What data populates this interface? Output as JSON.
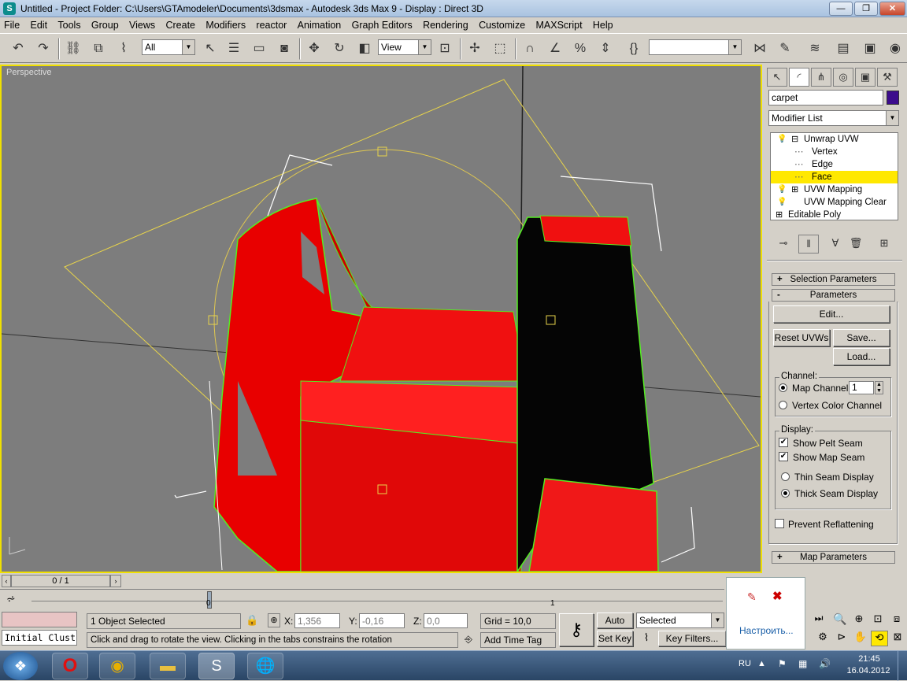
{
  "titlebar": {
    "app_icon": "3ds-max-icon",
    "title": "Untitled      - Project Folder: C:\\Users\\GTAmodeler\\Documents\\3dsmax     - Autodesk 3ds Max 9      - Display : Direct 3D",
    "minimize": "—",
    "maximize": "❐",
    "close": "✕"
  },
  "menu": [
    "File",
    "Edit",
    "Tools",
    "Group",
    "Views",
    "Create",
    "Modifiers",
    "reactor",
    "Animation",
    "Graph Editors",
    "Rendering",
    "Customize",
    "MAXScript",
    "Help"
  ],
  "toolbar": {
    "selection_filter": "All",
    "coord_system": "View",
    "named_selection": ""
  },
  "viewport": {
    "label": "Perspective"
  },
  "command_panel": {
    "object_name": "carpet",
    "object_color": "#3c0c8c",
    "modifier_list": "Modifier List",
    "stack": [
      {
        "label": "Unwrap UVW",
        "level": 0,
        "expand": "⊟",
        "bulb": true,
        "selected": false
      },
      {
        "label": "Vertex",
        "level": 2,
        "expand": "",
        "bulb": false,
        "selected": false
      },
      {
        "label": "Edge",
        "level": 2,
        "expand": "",
        "bulb": false,
        "selected": false
      },
      {
        "label": "Face",
        "level": 2,
        "expand": "",
        "bulb": false,
        "selected": true
      },
      {
        "label": "UVW Mapping",
        "level": 0,
        "expand": "⊞",
        "bulb": true,
        "selected": false
      },
      {
        "label": "UVW Mapping Clear",
        "level": 0,
        "expand": "",
        "bulb": true,
        "selected": false
      },
      {
        "label": "Editable Poly",
        "level": 0,
        "expand": "⊞",
        "bulb": false,
        "selected": false
      }
    ],
    "rollout_selection": "Selection Parameters",
    "rollout_parameters": "Parameters",
    "edit_btn": "Edit...",
    "reset_btn": "Reset UVWs",
    "save_btn": "Save...",
    "load_btn": "Load...",
    "channel_group": "Channel:",
    "map_channel_label": "Map Channel:",
    "map_channel_value": "1",
    "vertex_color_label": "Vertex Color Channel",
    "display_group": "Display:",
    "show_pelt_seam": "Show Pelt Seam",
    "show_map_seam": "Show Map Seam",
    "thin_seam": "Thin Seam Display",
    "thick_seam": "Thick Seam Display",
    "prevent_reflattening": "Prevent Reflattening",
    "rollout_map_params": "Map Parameters",
    "plus": "+",
    "minus": "-",
    "check": "✔"
  },
  "timeline": {
    "frame_counter": "0 / 1",
    "track_start": "0",
    "track_end": "1"
  },
  "status": {
    "maxscript_line": "Initial Clust",
    "selection": "1 Object Selected",
    "prompt": "Click and drag to rotate the view.  Clicking in the tabs constrains the rotation",
    "x_label": "X:",
    "x_value": "1,356",
    "y_label": "Y:",
    "y_value": "-0,16",
    "z_label": "Z:",
    "z_value": "0,0",
    "grid": "Grid = 10,0",
    "add_time_tag": "Add Time Tag",
    "auto_key": "Auto Key",
    "set_key": "Set Key",
    "key_mode": "Selected",
    "key_filters": "Key Filters..."
  },
  "popup": {
    "customize": "Настроить..."
  },
  "taskbar": {
    "lang": "RU",
    "time": "21:45",
    "date": "16.04.2012"
  }
}
